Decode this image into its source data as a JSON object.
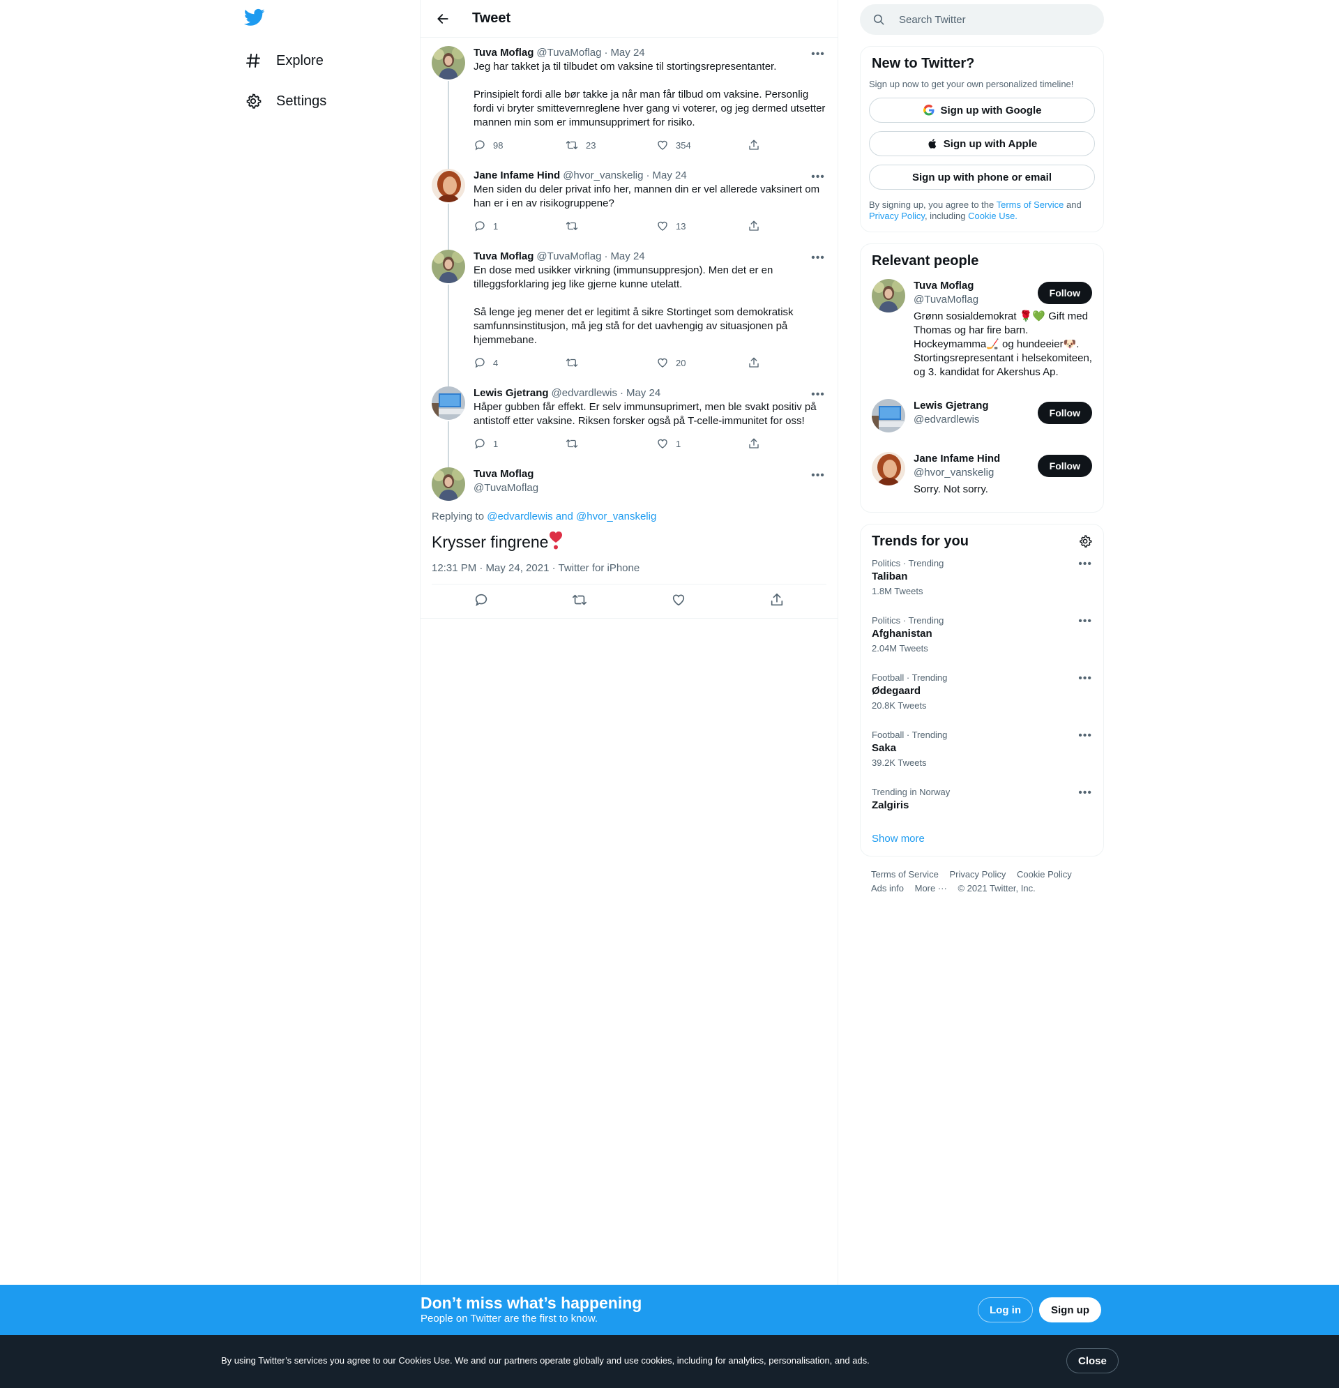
{
  "nav": {
    "logo": "twitter-bird-icon",
    "items": [
      {
        "label": "Explore",
        "icon": "hashtag-icon"
      },
      {
        "label": "Settings",
        "icon": "gear-icon"
      }
    ]
  },
  "header": {
    "title": "Tweet",
    "back_icon": "arrow-left-icon"
  },
  "thread": [
    {
      "name": "Tuva Moflag",
      "handle": "@TuvaMoflag",
      "sep": "·",
      "date": "May 24",
      "text": "Jeg har takket ja til tilbudet om vaksine til stortingsrepresentanter.\n\nPrinsipielt fordi alle bør takke ja når man får tilbud om vaksine. Personlig fordi vi bryter smittevernreglene hver gang vi voterer, og jeg dermed utsetter mannen min som er immunsupprimert for risiko.",
      "replies": "98",
      "retweets": "23",
      "likes": "354"
    },
    {
      "name": "Jane Infame Hind",
      "handle": "@hvor_vanskelig",
      "sep": "·",
      "date": "May 24",
      "text": "Men siden du deler privat info her, mannen din er vel allerede vaksinert om han er i en av risikogruppene?",
      "replies": "1",
      "retweets": "",
      "likes": "13"
    },
    {
      "name": "Tuva Moflag",
      "handle": "@TuvaMoflag",
      "sep": "·",
      "date": "May 24",
      "text": "En dose med usikker virkning (immunsuppresjon). Men det er en tilleggsforklaring jeg like gjerne kunne utelatt.\n\nSå lenge jeg mener det er legitimt å sikre Stortinget som demokratisk samfunnsinstitusjon, må jeg stå for det uavhengig av situasjonen på hjemmebane.",
      "replies": "4",
      "retweets": "",
      "likes": "20"
    },
    {
      "name": "Lewis Gjetrang",
      "handle": "@edvardlewis",
      "sep": "·",
      "date": "May 24",
      "text": "Håper gubben får effekt. Er selv immunsuprimert, men ble svakt positiv på antistoff etter vaksine. Riksen forsker også på T-celle-immunitet for oss!",
      "replies": "1",
      "retweets": "",
      "likes": "1"
    }
  ],
  "focal": {
    "name": "Tuva Moflag",
    "handle": "@TuvaMoflag",
    "replying_prefix": "Replying to ",
    "replying_to": "@edvardlewis and @hvor_vanskelig",
    "text": "Krysser fingrene",
    "emoji": "heavy-heart-exclamation",
    "meta": "12:31 PM · May 24, 2021 · Twitter for iPhone"
  },
  "search": {
    "placeholder": "Search Twitter"
  },
  "new_to_twitter": {
    "title": "New to Twitter?",
    "subtitle": "Sign up now to get your own personalized timeline!",
    "google": "Sign up with Google",
    "apple": "Sign up with Apple",
    "email": "Sign up with phone or email",
    "legal_1": "By signing up, you agree to the ",
    "tos": "Terms of Service",
    "legal_2": " and ",
    "privacy": "Privacy Policy",
    "legal_3": ", including ",
    "cookie": "Cookie Use."
  },
  "relevant": {
    "title": "Relevant people",
    "follow_label": "Follow",
    "people": [
      {
        "name": "Tuva Moflag",
        "handle": "@TuvaMoflag",
        "bio": "Grønn sosialdemokrat 🌹💚 Gift med Thomas og har fire barn. Hockeymamma🏒 og hundeeier🐶. Stortingsrepresentant i helsekomiteen, og 3. kandidat for Akershus Ap."
      },
      {
        "name": "Lewis Gjetrang",
        "handle": "@edvardlewis",
        "bio": ""
      },
      {
        "name": "Jane Infame Hind",
        "handle": "@hvor_vanskelig",
        "bio": "Sorry. Not sorry."
      }
    ]
  },
  "trends": {
    "title": "Trends for you",
    "items": [
      {
        "meta": "Politics · Trending",
        "name": "Taliban",
        "count": "1.8M Tweets"
      },
      {
        "meta": "Politics · Trending",
        "name": "Afghanistan",
        "count": "2.04M Tweets"
      },
      {
        "meta": "Football · Trending",
        "name": "Ødegaard",
        "count": "20.8K Tweets"
      },
      {
        "meta": "Football · Trending",
        "name": "Saka",
        "count": "39.2K Tweets"
      },
      {
        "meta": "Trending in Norway",
        "name": "Zalgiris",
        "count": ""
      }
    ],
    "show_more": "Show more"
  },
  "footer": {
    "tos": "Terms of Service",
    "privacy": "Privacy Policy",
    "cookie": "Cookie Policy",
    "ads": "Ads info",
    "more": "More ···",
    "copyright": "© 2021 Twitter, Inc."
  },
  "signup_bar": {
    "headline": "Don’t miss what’s happening",
    "sub": "People on Twitter are the first to know.",
    "login": "Log in",
    "signup": "Sign up"
  },
  "cookie_bar": {
    "text": "By using Twitter’s services you agree to our Cookies Use. We and our partners operate globally and use cookies, including for analytics, personalisation, and ads.",
    "close": "Close"
  },
  "colors": {
    "accent": "#1d9bf0",
    "text": "#0f1419",
    "muted": "#536471",
    "border": "#eff3f4",
    "cookie_bg": "#15202b"
  }
}
